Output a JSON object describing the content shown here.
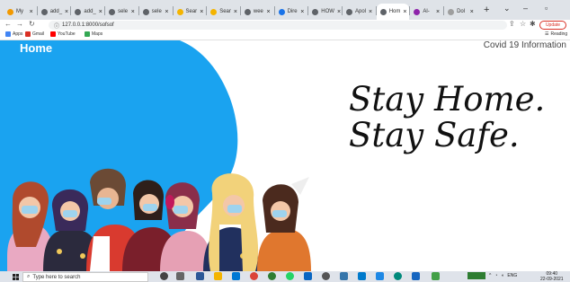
{
  "browser": {
    "tabs": [
      {
        "label": "My",
        "favicon_color": "#f29900"
      },
      {
        "label": "add_",
        "favicon_color": "#5f6368"
      },
      {
        "label": "add_",
        "favicon_color": "#5f6368"
      },
      {
        "label": "sele",
        "favicon_color": "#5f6368"
      },
      {
        "label": "sele",
        "favicon_color": "#5f6368"
      },
      {
        "label": "Sear",
        "favicon_color": "#f4b400"
      },
      {
        "label": "Sear",
        "favicon_color": "#f4b400"
      },
      {
        "label": "wee",
        "favicon_color": "#5f6368"
      },
      {
        "label": "Dire",
        "favicon_color": "#1a73e8"
      },
      {
        "label": "HOW",
        "favicon_color": "#5f6368"
      },
      {
        "label": "Apol",
        "favicon_color": "#5f6368"
      },
      {
        "label": "Hom",
        "favicon_color": "#5f6368",
        "active": true
      },
      {
        "label": "Al-",
        "favicon_color": "#8e24aa"
      },
      {
        "label": "Dol",
        "favicon_color": "#9e9e9e"
      }
    ],
    "new_tab": "+",
    "address": "127.0.0.1:8000/sofsof",
    "profile_label": "Update",
    "bookmarks": [
      {
        "label": "Apps",
        "color": "#4285f4"
      },
      {
        "label": "Gmail",
        "color": "#d93025"
      },
      {
        "label": "YouTube",
        "color": "#ff0000"
      },
      {
        "label": "Maps",
        "color": "#34a853"
      }
    ],
    "reading_list": "Reading"
  },
  "page": {
    "nav_home": "Home",
    "nav_right": "Covid 19 Information",
    "hero_line1": "Stay Home.",
    "hero_line2": "Stay Safe.",
    "accent_color": "#1aa3f0"
  },
  "taskbar": {
    "search_placeholder": "Type here to search",
    "tray_lang": "ENG",
    "time": "09:40",
    "date": "22-09-2021"
  }
}
